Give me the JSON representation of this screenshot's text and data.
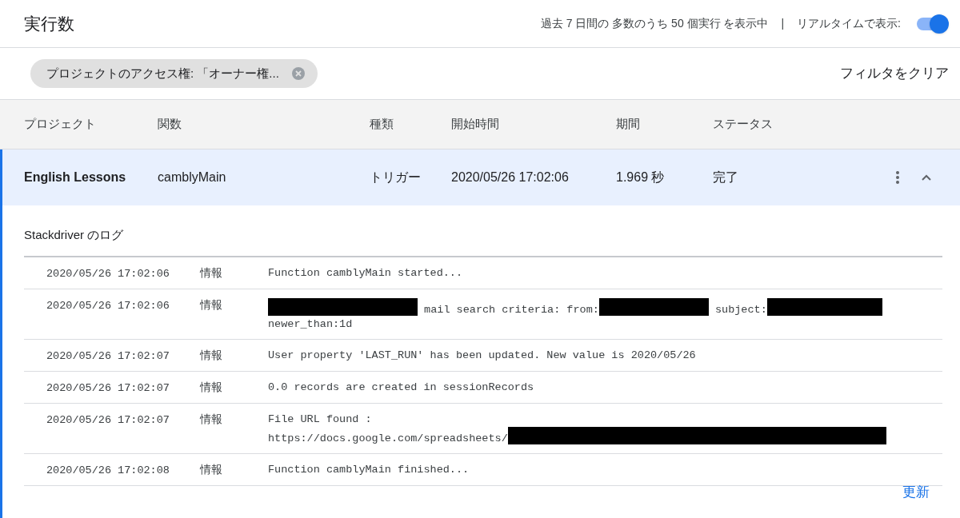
{
  "header": {
    "title": "実行数",
    "summary": "過去 7 日間の 多数のうち 50 個実行 を表示中",
    "separator": "|",
    "realtime_label": "リアルタイムで表示:",
    "realtime_on": true
  },
  "filter": {
    "chip": "プロジェクトのアクセス権: 「オーナー権...",
    "clear": "フィルタをクリア"
  },
  "table": {
    "columns": [
      "プロジェクト",
      "関数",
      "種類",
      "開始時間",
      "期間",
      "ステータス"
    ],
    "rows": [
      {
        "selected": true,
        "expanded": true,
        "cells": [
          "English Lessons",
          "camblyMain",
          "トリガー",
          "2020/05/26 17:02:06",
          "1.969 秒",
          "完了"
        ]
      }
    ]
  },
  "logs": {
    "title": "Stackdriver のログ",
    "entries": [
      {
        "time": "2020/05/26 17:02:06",
        "level": "情報",
        "message": [
          {
            "kind": "text",
            "text": "Function camblyMain started..."
          }
        ]
      },
      {
        "time": "2020/05/26 17:02:06",
        "level": "情報",
        "message": [
          {
            "kind": "redacted"
          },
          {
            "kind": "text",
            "text": " mail search criteria: from:"
          },
          {
            "kind": "redacted"
          },
          {
            "kind": "text",
            "text": " subject:"
          },
          {
            "kind": "redacted"
          },
          {
            "kind": "break"
          },
          {
            "kind": "text",
            "text": "newer_than:1d"
          }
        ]
      },
      {
        "time": "2020/05/26 17:02:07",
        "level": "情報",
        "message": [
          {
            "kind": "text",
            "text": "User property 'LAST_RUN' has been updated. New value is 2020/05/26"
          }
        ]
      },
      {
        "time": "2020/05/26 17:02:07",
        "level": "情報",
        "message": [
          {
            "kind": "text",
            "text": "0.0 records are created in sessionRecords"
          }
        ]
      },
      {
        "time": "2020/05/26 17:02:07",
        "level": "情報",
        "message": [
          {
            "kind": "text",
            "text": "File URL found :"
          },
          {
            "kind": "break"
          },
          {
            "kind": "text",
            "text": "https://docs.google.com/spreadsheets/"
          },
          {
            "kind": "redacted"
          }
        ]
      },
      {
        "time": "2020/05/26 17:02:08",
        "level": "情報",
        "message": [
          {
            "kind": "text",
            "text": "Function camblyMain finished..."
          }
        ]
      }
    ],
    "refresh": "更新"
  }
}
